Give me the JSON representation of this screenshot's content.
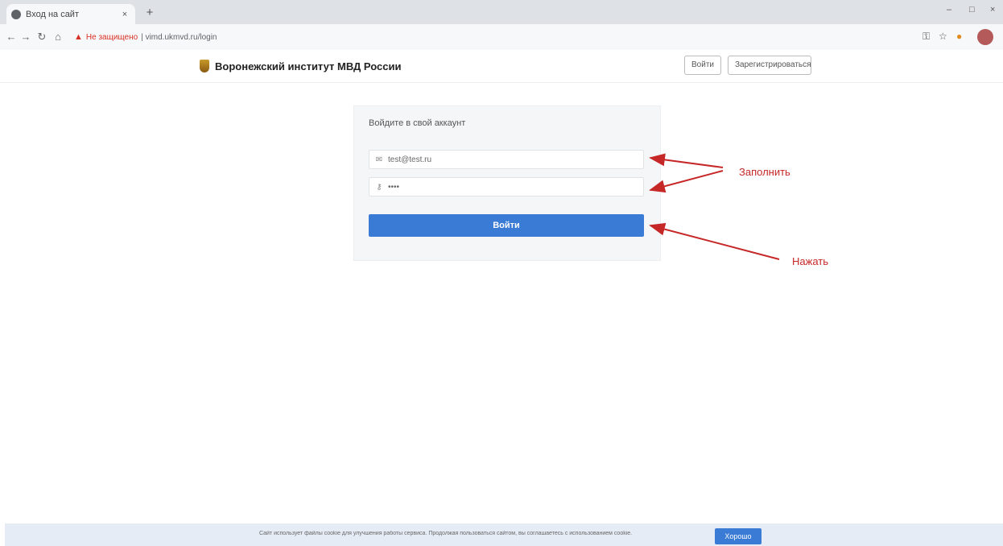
{
  "browser": {
    "tab_title": "Вход на сайт",
    "tab_close": "×",
    "new_tab": "+",
    "insecure_label": "Не защищено",
    "url": "| vimd.ukmvd.ru/login",
    "win_minimize": "–",
    "win_maximize": "□",
    "win_close": "×",
    "back": "←",
    "forward": "→",
    "reload": "↻",
    "home": "⌂"
  },
  "site": {
    "brand": "Воронежский институт МВД России",
    "header_login": "Войти",
    "header_register": "Зарегистрироваться"
  },
  "login": {
    "title": "Войдите в свой аккаунт",
    "login_value": "test@test.ru",
    "password_value": "••••",
    "submit": "Войти"
  },
  "annotations": {
    "fill": "Заполнить",
    "press": "Нажать"
  },
  "cookie": {
    "text": "Сайт использует файлы cookie для улучшения работы сервиса. Продолжая пользоваться сайтом, вы соглашаетесь с использованием cookie.",
    "accept": "Хорошо"
  },
  "colors": {
    "accent": "#3a7bd5",
    "annotation": "#c62828"
  }
}
